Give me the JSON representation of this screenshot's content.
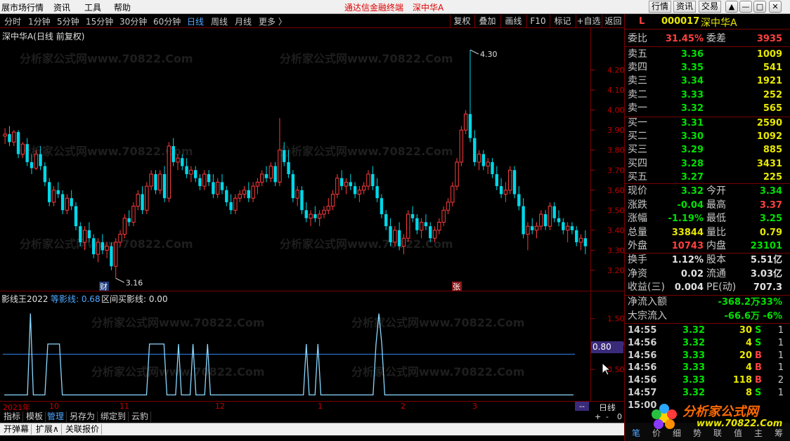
{
  "menubar": {
    "items": [
      "展市场行情",
      "资讯",
      "工具",
      "帮助"
    ],
    "center_title": "通达信金融终端",
    "center_stock": "深中华A",
    "right_buttons": [
      "行情",
      "资讯",
      "交易"
    ],
    "win_buttons": [
      "▲",
      "—",
      "□",
      "✕"
    ]
  },
  "toolbar": {
    "periods": [
      "分时",
      "1分钟",
      "5分钟",
      "15分钟",
      "30分钟",
      "60分钟",
      "日线",
      "周线",
      "月线",
      "更多 〉"
    ],
    "active_period": "日线",
    "right_buttons": [
      "复权",
      "叠加",
      "画线",
      "F10",
      "标记",
      "+自选",
      "返回"
    ]
  },
  "main_chart": {
    "title": "深中华A(日线 前复权)",
    "y_ticks": [
      "4.20",
      "4.10",
      "4.00",
      "3.90",
      "3.80",
      "3.70",
      "3.60",
      "3.50",
      "3.40",
      "3.30",
      "3.20"
    ],
    "high_label": "4.30",
    "low_label": "3.16",
    "marker_cai": "财",
    "marker_zhang": "张",
    "watermark": "分析家公式网www.70822.Com",
    "up_color": "#ff3c3c",
    "down_color": "#00d8e8"
  },
  "indicator": {
    "name": "影线王2022",
    "line1_label": "等影线: 0.68",
    "line2_label": "区间买影线: 0.00",
    "y_ticks": [
      "1.50",
      "1.00",
      "0.50"
    ],
    "current_value": "0.80"
  },
  "time_axis": {
    "labels": [
      "2021年",
      "10",
      "11",
      "12",
      "1",
      "2",
      "3"
    ],
    "corner": "--",
    "period_label": "日线",
    "zoom_btns": [
      "+",
      "-",
      "0"
    ]
  },
  "bottom_tabs": {
    "row1": [
      "指标",
      "模板",
      "管理",
      "另存为",
      "绑定到",
      "云豹"
    ],
    "row1_selected": "管理",
    "row2": [
      "开弹幕",
      "扩展∧",
      "关联报价"
    ]
  },
  "quote_panel": {
    "flag": "L",
    "code": "000017",
    "name": "深中华A",
    "weibi_label": "委比",
    "weibi": "31.45%",
    "weicha_label": "委差",
    "weicha": "3935",
    "asks": [
      {
        "label": "卖五",
        "price": "3.36",
        "vol": "1009"
      },
      {
        "label": "卖四",
        "price": "3.35",
        "vol": "541"
      },
      {
        "label": "卖三",
        "price": "3.34",
        "vol": "1921"
      },
      {
        "label": "卖二",
        "price": "3.33",
        "vol": "252"
      },
      {
        "label": "卖一",
        "price": "3.32",
        "vol": "565"
      }
    ],
    "bids": [
      {
        "label": "买一",
        "price": "3.31",
        "vol": "2590"
      },
      {
        "label": "买二",
        "price": "3.30",
        "vol": "1092"
      },
      {
        "label": "买三",
        "price": "3.29",
        "vol": "885"
      },
      {
        "label": "买四",
        "price": "3.28",
        "vol": "3431"
      },
      {
        "label": "买五",
        "price": "3.27",
        "vol": "225"
      }
    ],
    "stats": [
      {
        "l1": "现价",
        "v1": "3.32",
        "c1": "green",
        "l2": "今开",
        "v2": "3.34",
        "c2": "green"
      },
      {
        "l1": "涨跌",
        "v1": "-0.04",
        "c1": "green",
        "l2": "最高",
        "v2": "3.37",
        "c2": "red"
      },
      {
        "l1": "涨幅",
        "v1": "-1.19%",
        "c1": "green",
        "l2": "最低",
        "v2": "3.25",
        "c2": "green"
      },
      {
        "l1": "总量",
        "v1": "33844",
        "c1": "yellow",
        "l2": "量比",
        "v2": "0.79",
        "c2": "yellow"
      },
      {
        "l1": "外盘",
        "v1": "10743",
        "c1": "red",
        "l2": "内盘",
        "v2": "23101",
        "c2": "green"
      }
    ],
    "fund": [
      {
        "l1": "换手",
        "v1": "1.12%",
        "l2": "股本",
        "v2": "5.51亿"
      },
      {
        "l1": "净资",
        "v1": "0.02",
        "l2": "流通",
        "v2": "3.03亿"
      },
      {
        "l1": "收益(三)",
        "v1": "0.004",
        "l2": "PE(动)",
        "v2": "707.3"
      }
    ],
    "flow": [
      {
        "l": "净流入额",
        "v": "-368.2万",
        "p": "-33%"
      },
      {
        "l": "大宗流入",
        "v": "-66.6万",
        "p": "-6%"
      }
    ],
    "ticks": [
      {
        "t": "14:55",
        "p": "3.32",
        "v": "30",
        "bs": "S",
        "n": "1"
      },
      {
        "t": "14:56",
        "p": "3.32",
        "v": "4",
        "bs": "S",
        "n": "1"
      },
      {
        "t": "14:56",
        "p": "3.33",
        "v": "20",
        "bs": "B",
        "n": "1"
      },
      {
        "t": "14:56",
        "p": "3.33",
        "v": "4",
        "bs": "B",
        "n": "1"
      },
      {
        "t": "14:56",
        "p": "3.33",
        "v": "118",
        "bs": "B",
        "n": "2"
      },
      {
        "t": "14:57",
        "p": "3.32",
        "v": "8",
        "bs": "S",
        "n": "1"
      },
      {
        "t": "15:00",
        "p": "",
        "v": "",
        "bs": "",
        "n": ""
      }
    ],
    "bottom_tabs": [
      "笔",
      "价",
      "细",
      "势",
      "联",
      "值",
      "主",
      "筹"
    ],
    "logo_text": "分析家公式网",
    "logo_url": "www.70822.Com"
  },
  "chart_data": {
    "type": "candlestick",
    "title": "深中华A(日线 前复权)",
    "ylim": [
      3.14,
      4.36
    ],
    "x_labels": [
      "10",
      "11",
      "12",
      "1",
      "2",
      "3"
    ],
    "candles": [
      [
        3.87,
        3.91,
        3.83,
        3.88
      ],
      [
        3.88,
        3.92,
        3.82,
        3.84
      ],
      [
        3.84,
        3.9,
        3.82,
        3.89
      ],
      [
        3.89,
        3.9,
        3.76,
        3.78
      ],
      [
        3.78,
        3.84,
        3.76,
        3.83
      ],
      [
        3.83,
        3.86,
        3.72,
        3.74
      ],
      [
        3.74,
        3.78,
        3.68,
        3.71
      ],
      [
        3.71,
        3.8,
        3.7,
        3.78
      ],
      [
        3.78,
        3.82,
        3.7,
        3.72
      ],
      [
        3.72,
        3.74,
        3.62,
        3.64
      ],
      [
        3.64,
        3.66,
        3.52,
        3.54
      ],
      [
        3.54,
        3.62,
        3.52,
        3.6
      ],
      [
        3.6,
        3.64,
        3.56,
        3.58
      ],
      [
        3.58,
        3.6,
        3.48,
        3.5
      ],
      [
        3.5,
        3.58,
        3.48,
        3.56
      ],
      [
        3.56,
        3.6,
        3.5,
        3.52
      ],
      [
        3.52,
        3.54,
        3.4,
        3.42
      ],
      [
        3.42,
        3.44,
        3.32,
        3.34
      ],
      [
        3.34,
        3.42,
        3.3,
        3.4
      ],
      [
        3.4,
        3.44,
        3.34,
        3.36
      ],
      [
        3.36,
        3.38,
        3.26,
        3.28
      ],
      [
        3.28,
        3.36,
        3.24,
        3.34
      ],
      [
        3.34,
        3.38,
        3.28,
        3.3
      ],
      [
        3.3,
        3.34,
        3.26,
        3.32
      ],
      [
        3.32,
        3.34,
        3.2,
        3.22
      ],
      [
        3.22,
        3.36,
        3.16,
        3.34
      ],
      [
        3.34,
        3.4,
        3.32,
        3.38
      ],
      [
        3.38,
        3.48,
        3.36,
        3.46
      ],
      [
        3.46,
        3.5,
        3.42,
        3.44
      ],
      [
        3.44,
        3.54,
        3.42,
        3.52
      ],
      [
        3.52,
        3.6,
        3.5,
        3.58
      ],
      [
        3.58,
        3.62,
        3.48,
        3.5
      ],
      [
        3.5,
        3.64,
        3.48,
        3.62
      ],
      [
        3.62,
        3.7,
        3.6,
        3.68
      ],
      [
        3.68,
        3.7,
        3.58,
        3.6
      ],
      [
        3.6,
        3.7,
        3.58,
        3.68
      ],
      [
        3.68,
        3.72,
        3.54,
        3.56
      ],
      [
        3.56,
        3.84,
        3.54,
        3.82
      ],
      [
        3.82,
        3.86,
        3.72,
        3.74
      ],
      [
        3.74,
        3.78,
        3.7,
        3.76
      ],
      [
        3.76,
        3.78,
        3.7,
        3.72
      ],
      [
        3.72,
        3.76,
        3.66,
        3.68
      ],
      [
        3.68,
        3.72,
        3.64,
        3.7
      ],
      [
        3.7,
        3.72,
        3.64,
        3.66
      ],
      [
        3.66,
        3.68,
        3.6,
        3.62
      ],
      [
        3.62,
        3.7,
        3.6,
        3.68
      ],
      [
        3.68,
        3.7,
        3.62,
        3.64
      ],
      [
        3.64,
        3.68,
        3.56,
        3.58
      ],
      [
        3.58,
        3.66,
        3.56,
        3.64
      ],
      [
        3.64,
        3.68,
        3.58,
        3.6
      ],
      [
        3.6,
        3.62,
        3.52,
        3.54
      ],
      [
        3.54,
        3.58,
        3.48,
        3.5
      ],
      [
        3.5,
        3.58,
        3.48,
        3.56
      ],
      [
        3.56,
        3.6,
        3.54,
        3.58
      ],
      [
        3.58,
        3.62,
        3.56,
        3.6
      ],
      [
        3.6,
        3.64,
        3.54,
        3.56
      ],
      [
        3.56,
        3.64,
        3.54,
        3.62
      ],
      [
        3.62,
        3.66,
        3.58,
        3.64
      ],
      [
        3.64,
        3.7,
        3.62,
        3.68
      ],
      [
        3.68,
        3.72,
        3.64,
        3.66
      ],
      [
        3.66,
        3.74,
        3.64,
        3.72
      ],
      [
        3.72,
        3.74,
        3.62,
        3.64
      ],
      [
        3.64,
        3.96,
        3.62,
        3.8
      ],
      [
        3.8,
        3.84,
        3.72,
        3.74
      ],
      [
        3.74,
        3.8,
        3.66,
        3.68
      ],
      [
        3.68,
        3.7,
        3.54,
        3.56
      ],
      [
        3.56,
        3.62,
        3.52,
        3.6
      ],
      [
        3.6,
        3.62,
        3.48,
        3.5
      ],
      [
        3.5,
        3.54,
        3.44,
        3.46
      ],
      [
        3.46,
        3.5,
        3.42,
        3.48
      ],
      [
        3.48,
        3.52,
        3.44,
        3.46
      ],
      [
        3.46,
        3.5,
        3.42,
        3.48
      ],
      [
        3.48,
        3.52,
        3.46,
        3.5
      ],
      [
        3.5,
        3.56,
        3.48,
        3.52
      ],
      [
        3.52,
        3.6,
        3.5,
        3.58
      ],
      [
        3.58,
        3.68,
        3.56,
        3.66
      ],
      [
        3.66,
        3.7,
        3.6,
        3.62
      ],
      [
        3.62,
        3.66,
        3.58,
        3.64
      ],
      [
        3.64,
        3.68,
        3.6,
        3.62
      ],
      [
        3.62,
        3.64,
        3.56,
        3.58
      ],
      [
        3.58,
        3.62,
        3.54,
        3.6
      ],
      [
        3.6,
        3.64,
        3.58,
        3.62
      ],
      [
        3.62,
        3.7,
        3.6,
        3.68
      ],
      [
        3.68,
        3.72,
        3.6,
        3.62
      ],
      [
        3.62,
        3.66,
        3.54,
        3.56
      ],
      [
        3.56,
        3.58,
        3.46,
        3.48
      ],
      [
        3.48,
        3.5,
        3.4,
        3.42
      ],
      [
        3.42,
        3.46,
        3.32,
        3.34
      ],
      [
        3.34,
        3.42,
        3.32,
        3.4
      ],
      [
        3.4,
        3.44,
        3.3,
        3.32
      ],
      [
        3.32,
        3.38,
        3.28,
        3.36
      ],
      [
        3.36,
        3.5,
        3.34,
        3.48
      ],
      [
        3.48,
        3.52,
        3.44,
        3.46
      ],
      [
        3.46,
        3.48,
        3.38,
        3.4
      ],
      [
        3.4,
        3.46,
        3.36,
        3.44
      ],
      [
        3.44,
        3.48,
        3.4,
        3.42
      ],
      [
        3.42,
        3.44,
        3.34,
        3.36
      ],
      [
        3.36,
        3.42,
        3.34,
        3.4
      ],
      [
        3.4,
        3.46,
        3.38,
        3.44
      ],
      [
        3.44,
        3.52,
        3.42,
        3.5
      ],
      [
        3.5,
        3.56,
        3.48,
        3.54
      ],
      [
        3.54,
        3.64,
        3.52,
        3.62
      ],
      [
        3.62,
        3.76,
        3.6,
        3.74
      ],
      [
        3.74,
        3.92,
        3.72,
        3.9
      ],
      [
        3.9,
        4.0,
        3.88,
        3.98
      ],
      [
        3.98,
        4.3,
        3.84,
        3.86
      ],
      [
        3.86,
        3.9,
        3.72,
        3.74
      ],
      [
        3.74,
        3.8,
        3.7,
        3.78
      ],
      [
        3.78,
        3.8,
        3.7,
        3.72
      ],
      [
        3.72,
        3.76,
        3.68,
        3.74
      ],
      [
        3.74,
        3.76,
        3.66,
        3.68
      ],
      [
        3.68,
        3.72,
        3.6,
        3.62
      ],
      [
        3.62,
        3.66,
        3.56,
        3.58
      ],
      [
        3.58,
        3.64,
        3.54,
        3.6
      ],
      [
        3.6,
        3.72,
        3.58,
        3.7
      ],
      [
        3.7,
        3.72,
        3.56,
        3.58
      ],
      [
        3.58,
        3.62,
        3.5,
        3.52
      ],
      [
        3.52,
        3.56,
        3.36,
        3.38
      ],
      [
        3.38,
        3.44,
        3.3,
        3.42
      ],
      [
        3.42,
        3.46,
        3.38,
        3.4
      ],
      [
        3.4,
        3.44,
        3.36,
        3.42
      ],
      [
        3.42,
        3.5,
        3.4,
        3.48
      ],
      [
        3.48,
        3.5,
        3.4,
        3.42
      ],
      [
        3.42,
        3.54,
        3.4,
        3.52
      ],
      [
        3.52,
        3.54,
        3.44,
        3.46
      ],
      [
        3.46,
        3.5,
        3.42,
        3.44
      ],
      [
        3.44,
        3.46,
        3.38,
        3.4
      ],
      [
        3.4,
        3.44,
        3.34,
        3.42
      ],
      [
        3.42,
        3.44,
        3.38,
        3.4
      ],
      [
        3.4,
        3.42,
        3.32,
        3.34
      ],
      [
        3.34,
        3.38,
        3.3,
        3.36
      ],
      [
        3.36,
        3.4,
        3.28,
        3.32
      ]
    ],
    "indicator_values": [
      0,
      0,
      0,
      0,
      0,
      0,
      0,
      0,
      0,
      1.6,
      0,
      0,
      0,
      0,
      0,
      1,
      1,
      1,
      1,
      1,
      0,
      0,
      0,
      0,
      0,
      0,
      0,
      0,
      0,
      0,
      0,
      0,
      0,
      0,
      0,
      0,
      0,
      0,
      0,
      0,
      0,
      0,
      0,
      0,
      0,
      0,
      0,
      0,
      0,
      0,
      1,
      1,
      1,
      1,
      1,
      1,
      0,
      0,
      0,
      0,
      1,
      0,
      0,
      0,
      0,
      1,
      0,
      0,
      0,
      0,
      1,
      0,
      0,
      0,
      0,
      0,
      0,
      0,
      0,
      0,
      0,
      0,
      0,
      0,
      0,
      0,
      0,
      0,
      0,
      0,
      0,
      0,
      0,
      0,
      0,
      0,
      0,
      0,
      0,
      0,
      0,
      0,
      0,
      0,
      1,
      0,
      0,
      0,
      1,
      0,
      0,
      0,
      0,
      0,
      0,
      0,
      0,
      0,
      0,
      0,
      0,
      0,
      0,
      0,
      0,
      0,
      0,
      0,
      1,
      1.6,
      1,
      0,
      0,
      0,
      0,
      0,
      0,
      0,
      0,
      0,
      0,
      0,
      0,
      0,
      0,
      0,
      0,
      0,
      0,
      0,
      0,
      0,
      0,
      0,
      0,
      0,
      0,
      0,
      0,
      0,
      0,
      0,
      0,
      0,
      0,
      0,
      0,
      0,
      0,
      0,
      0,
      0,
      0,
      0,
      0,
      0,
      0,
      0,
      0,
      0,
      0,
      0,
      0,
      0,
      0,
      0,
      0,
      0,
      0,
      0,
      0,
      0,
      0,
      0,
      0,
      0,
      0
    ],
    "indicator_ylim": [
      -0.05,
      1.8
    ],
    "horizontal_line": 0.8
  }
}
